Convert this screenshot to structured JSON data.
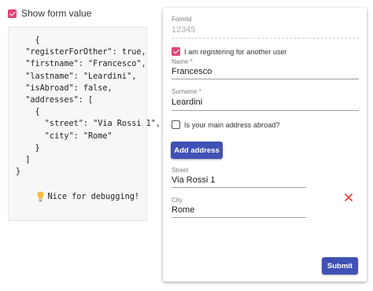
{
  "show_toggle": {
    "label": "Show form value",
    "checked": true
  },
  "json_panel": {
    "lines": [
      "    {",
      "  \"registerForOther\": true,",
      "  \"firstname\": \"Francesco\",",
      "  \"lastname\": \"Leardini\",",
      "  \"isAbroad\": false,",
      "  \"addresses\": [",
      "    {",
      "      \"street\": \"Via Rossi 1\",",
      "      \"city\": \"Rome\"",
      "    }",
      "  ]",
      "}"
    ],
    "note": "Nice for debugging!",
    "note_icon": "lightbulb-icon"
  },
  "form": {
    "form_id": {
      "label": "FormId",
      "value": "12345"
    },
    "register_for_other": {
      "label": "I am registering for another user",
      "checked": true
    },
    "name": {
      "label": "Name *",
      "value": "Francesco"
    },
    "surname": {
      "label": "Surname *",
      "value": "Leardini"
    },
    "abroad": {
      "label": "Is your main address abroad?",
      "checked": false
    },
    "add_address_label": "Add address",
    "street": {
      "label": "Street",
      "value": "Via Rossi 1"
    },
    "city": {
      "label": "City",
      "value": "Rome"
    },
    "remove_icon": "close-icon",
    "submit_label": "Submit"
  },
  "colors": {
    "accent_pink": "#e0467c",
    "primary_indigo": "#3f51b5",
    "remove_red": "#e53935"
  }
}
